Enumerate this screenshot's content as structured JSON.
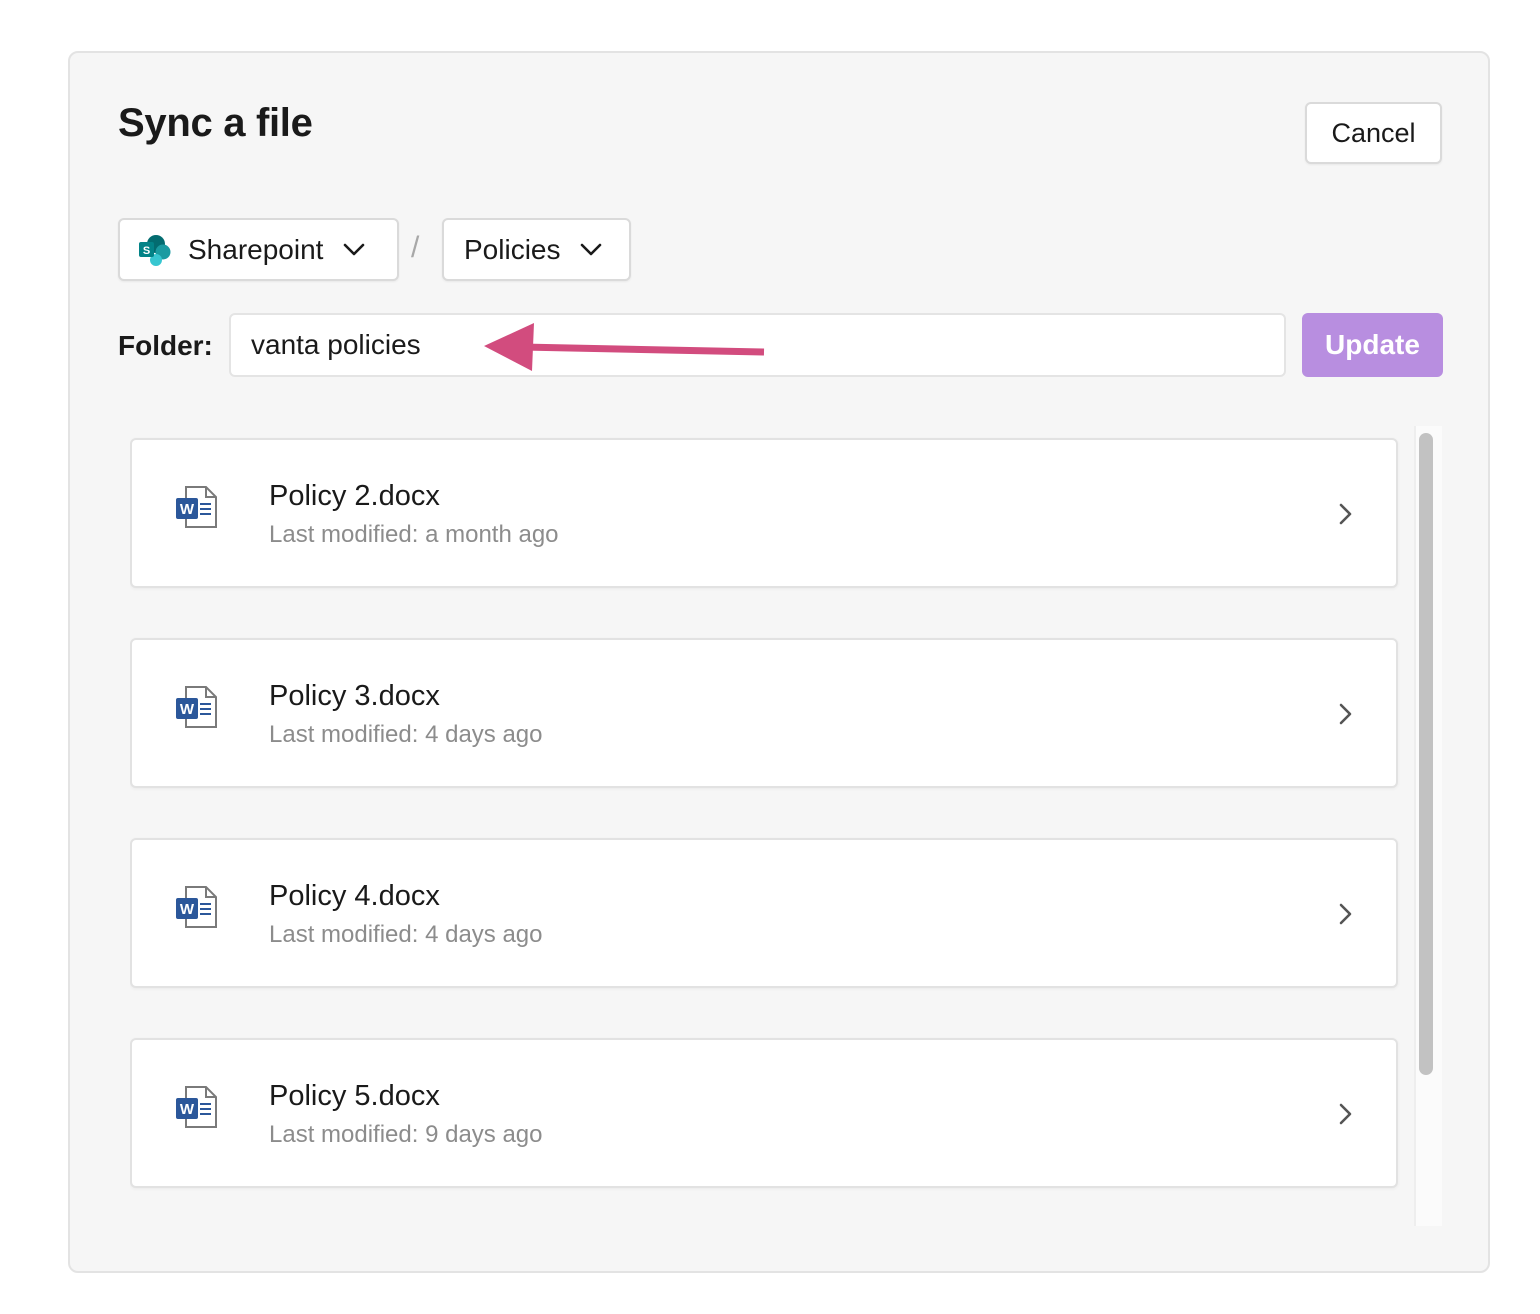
{
  "dialog": {
    "title": "Sync a file",
    "cancel_label": "Cancel"
  },
  "breadcrumb": {
    "source": {
      "label": "Sharepoint",
      "icon": "sharepoint-icon"
    },
    "separator": "/",
    "library": {
      "label": "Policies"
    }
  },
  "folder": {
    "label": "Folder:",
    "value": "vanta policies",
    "update_label": "Update"
  },
  "files": [
    {
      "name": "Policy 2.docx",
      "modified": "Last modified: a month ago",
      "icon": "word-doc-icon"
    },
    {
      "name": "Policy 3.docx",
      "modified": "Last modified: 4 days ago",
      "icon": "word-doc-icon"
    },
    {
      "name": "Policy 4.docx",
      "modified": "Last modified: 4 days ago",
      "icon": "word-doc-icon"
    },
    {
      "name": "Policy 5.docx",
      "modified": "Last modified: 9 days ago",
      "icon": "word-doc-icon"
    }
  ],
  "colors": {
    "accent_button": "#b88ee0",
    "annotation_arrow": "#d24c7e",
    "dialog_bg": "#f6f6f6"
  }
}
